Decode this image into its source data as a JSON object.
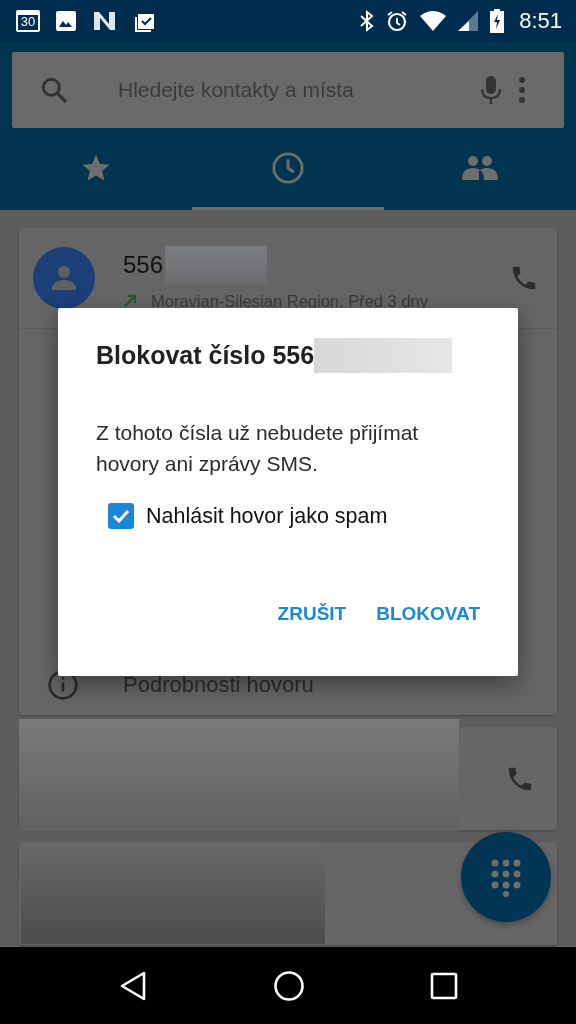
{
  "status_bar": {
    "time": "8:51",
    "calendar_day": "30"
  },
  "search": {
    "placeholder": "Hledejte kontakty a místa"
  },
  "tabs": [
    {
      "kind": "favorites",
      "selected": false
    },
    {
      "kind": "recent",
      "selected": true
    },
    {
      "kind": "contacts",
      "selected": false
    }
  ],
  "call_entry": {
    "number": "556",
    "subtitle": "Moravian-Silesian Region, Před 3 dny",
    "menu_item": "Podrobnosti hovoru"
  },
  "dialog": {
    "title": "Blokovat číslo 556",
    "message": "Z tohoto čísla už nebudete přijímat hovory ani zprávy SMS.",
    "checkbox": {
      "label": "Nahlásit hovor jako spam",
      "checked": true
    },
    "buttons": [
      "ZRUŠIT",
      "BLOKOVAT"
    ]
  }
}
